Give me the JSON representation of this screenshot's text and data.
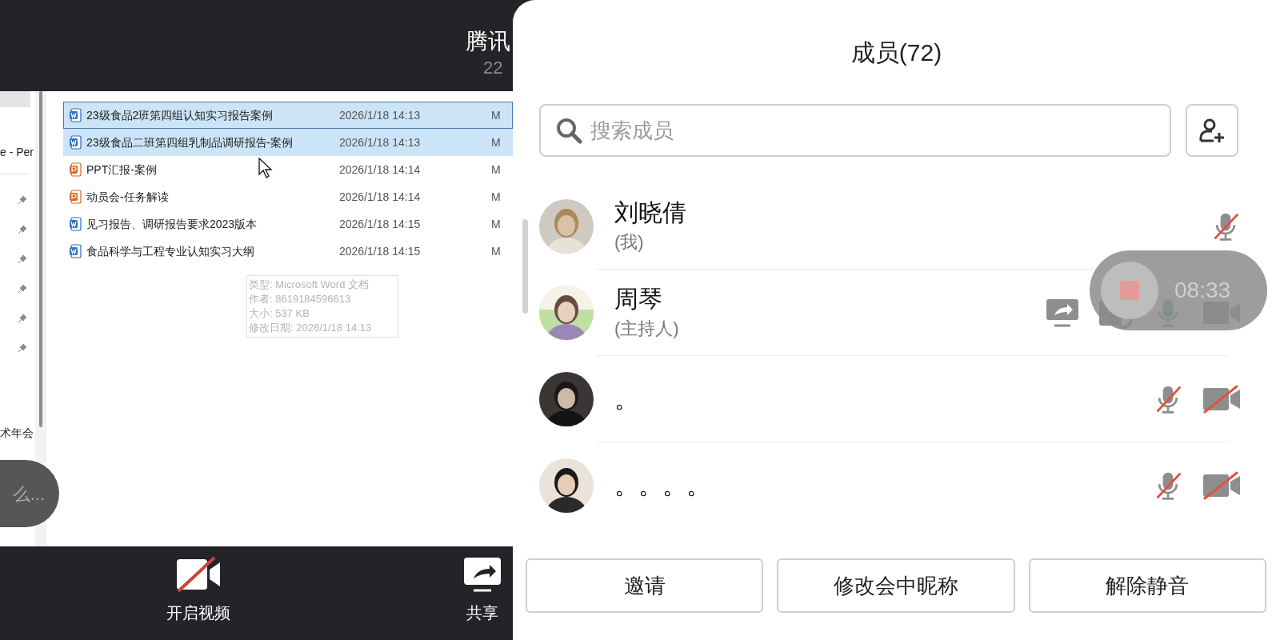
{
  "meeting": {
    "title": "腾讯",
    "subtitle": "22"
  },
  "explorer": {
    "nav_label": "e - Per",
    "nav_items": [
      {
        "pinned": true
      },
      {
        "pinned": true
      },
      {
        "pinned": true
      },
      {
        "pinned": true
      },
      {
        "pinned": true
      },
      {
        "pinned": true
      }
    ],
    "nav_footer": "术年会",
    "files": [
      {
        "kind": "word",
        "name": "23级食品2班第四组认知实习报告案例",
        "date": "2026/1/18 14:13",
        "column_3": "M",
        "selected": true,
        "focused": true
      },
      {
        "kind": "word",
        "name": "23级食品二班第四组乳制品调研报告-案例",
        "date": "2026/1/18 14:13",
        "column_3": "M",
        "selected": true,
        "focused": false
      },
      {
        "kind": "ppt",
        "name": "PPT汇报-案例",
        "date": "2026/1/18 14:14",
        "column_3": "M",
        "selected": false,
        "focused": false
      },
      {
        "kind": "ppt",
        "name": "动员会-任务解读",
        "date": "2026/1/18 14:14",
        "column_3": "M",
        "selected": false,
        "focused": false
      },
      {
        "kind": "word",
        "name": "见习报告、调研报告要求2023版本",
        "date": "2026/1/18 14:15",
        "column_3": "M",
        "selected": false,
        "focused": false
      },
      {
        "kind": "word",
        "name": "食品科学与工程专业认知实习大纲",
        "date": "2026/1/18 14:15",
        "column_3": "M",
        "selected": false,
        "focused": false
      }
    ],
    "tooltip": [
      "类型: Microsoft Word 文档",
      "作者: 8619184596613",
      "大小: 537 KB",
      "修改日期: 2026/1/18 14:13"
    ]
  },
  "chat_bubble": "么...",
  "toolbar": [
    {
      "kind": "video",
      "label": "开启视频",
      "on": false
    },
    {
      "kind": "share",
      "label": "共享"
    }
  ],
  "panel": {
    "title": "成员(72)",
    "search": {
      "placeholder": "搜索成员"
    },
    "members": [
      {
        "name": "刘晓倩",
        "role": "(我)",
        "controls": [
          {
            "kind": "mic",
            "on": false
          }
        ]
      },
      {
        "name": "周琴",
        "role": "(主持人)",
        "controls": [
          {
            "kind": "share"
          },
          {
            "kind": "device"
          },
          {
            "kind": "mic",
            "on": true
          },
          {
            "kind": "camera",
            "on": true
          }
        ]
      },
      {
        "name": "。",
        "controls": [
          {
            "kind": "mic",
            "on": false
          },
          {
            "kind": "camera",
            "on": false
          }
        ]
      },
      {
        "name": "。。。。",
        "controls": [
          {
            "kind": "mic",
            "on": false
          },
          {
            "kind": "camera",
            "on": false
          }
        ]
      }
    ],
    "recording": {
      "time": "08:33"
    },
    "buttons": [
      "邀请",
      "修改会中昵称",
      "解除静音"
    ]
  }
}
